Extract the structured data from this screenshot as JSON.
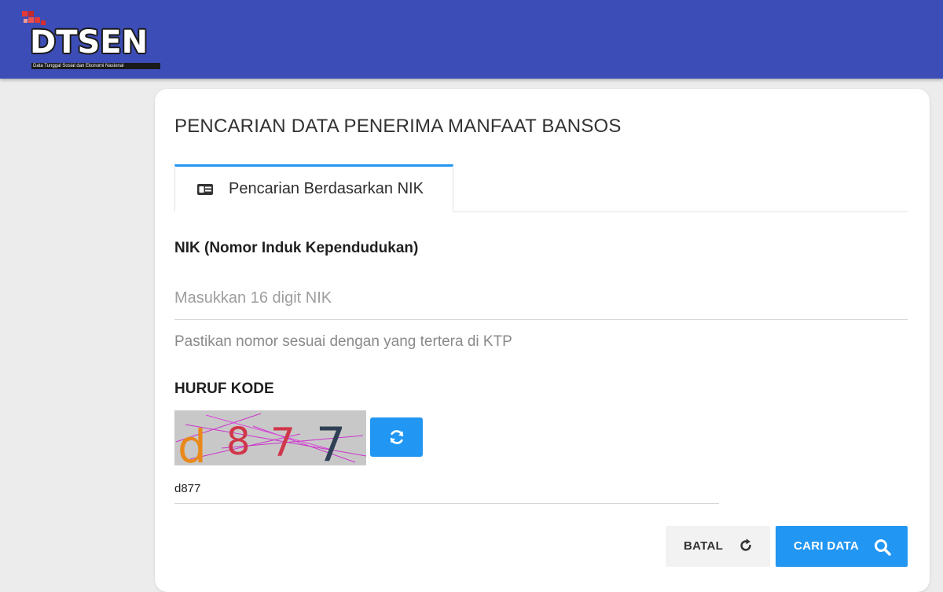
{
  "header": {
    "logo_text": "DTSEN",
    "logo_subtitle": "Data Tunggal Sosial dan Ekonomi Nasional",
    "bg_color": "#3d4db7"
  },
  "page": {
    "title": "PENCARIAN DATA PENERIMA MANFAAT BANSOS"
  },
  "tabs": [
    {
      "label": "Pencarian Berdasarkan NIK",
      "icon": "id-card-icon",
      "active": true
    }
  ],
  "nik": {
    "label": "NIK (Nomor Induk Kependudukan)",
    "placeholder": "Masukkan 16 digit NIK",
    "value": "",
    "helper": "Pastikan nomor sesuai dengan yang tertera di KTP"
  },
  "captcha": {
    "label": "HURUF KODE",
    "code": "d877",
    "input_value": "d877",
    "refresh_icon": "refresh-icon"
  },
  "actions": {
    "cancel_label": "BATAL",
    "cancel_icon": "reset-icon",
    "search_label": "CARI DATA",
    "search_icon": "search-icon",
    "accent_color": "#2196f3"
  }
}
